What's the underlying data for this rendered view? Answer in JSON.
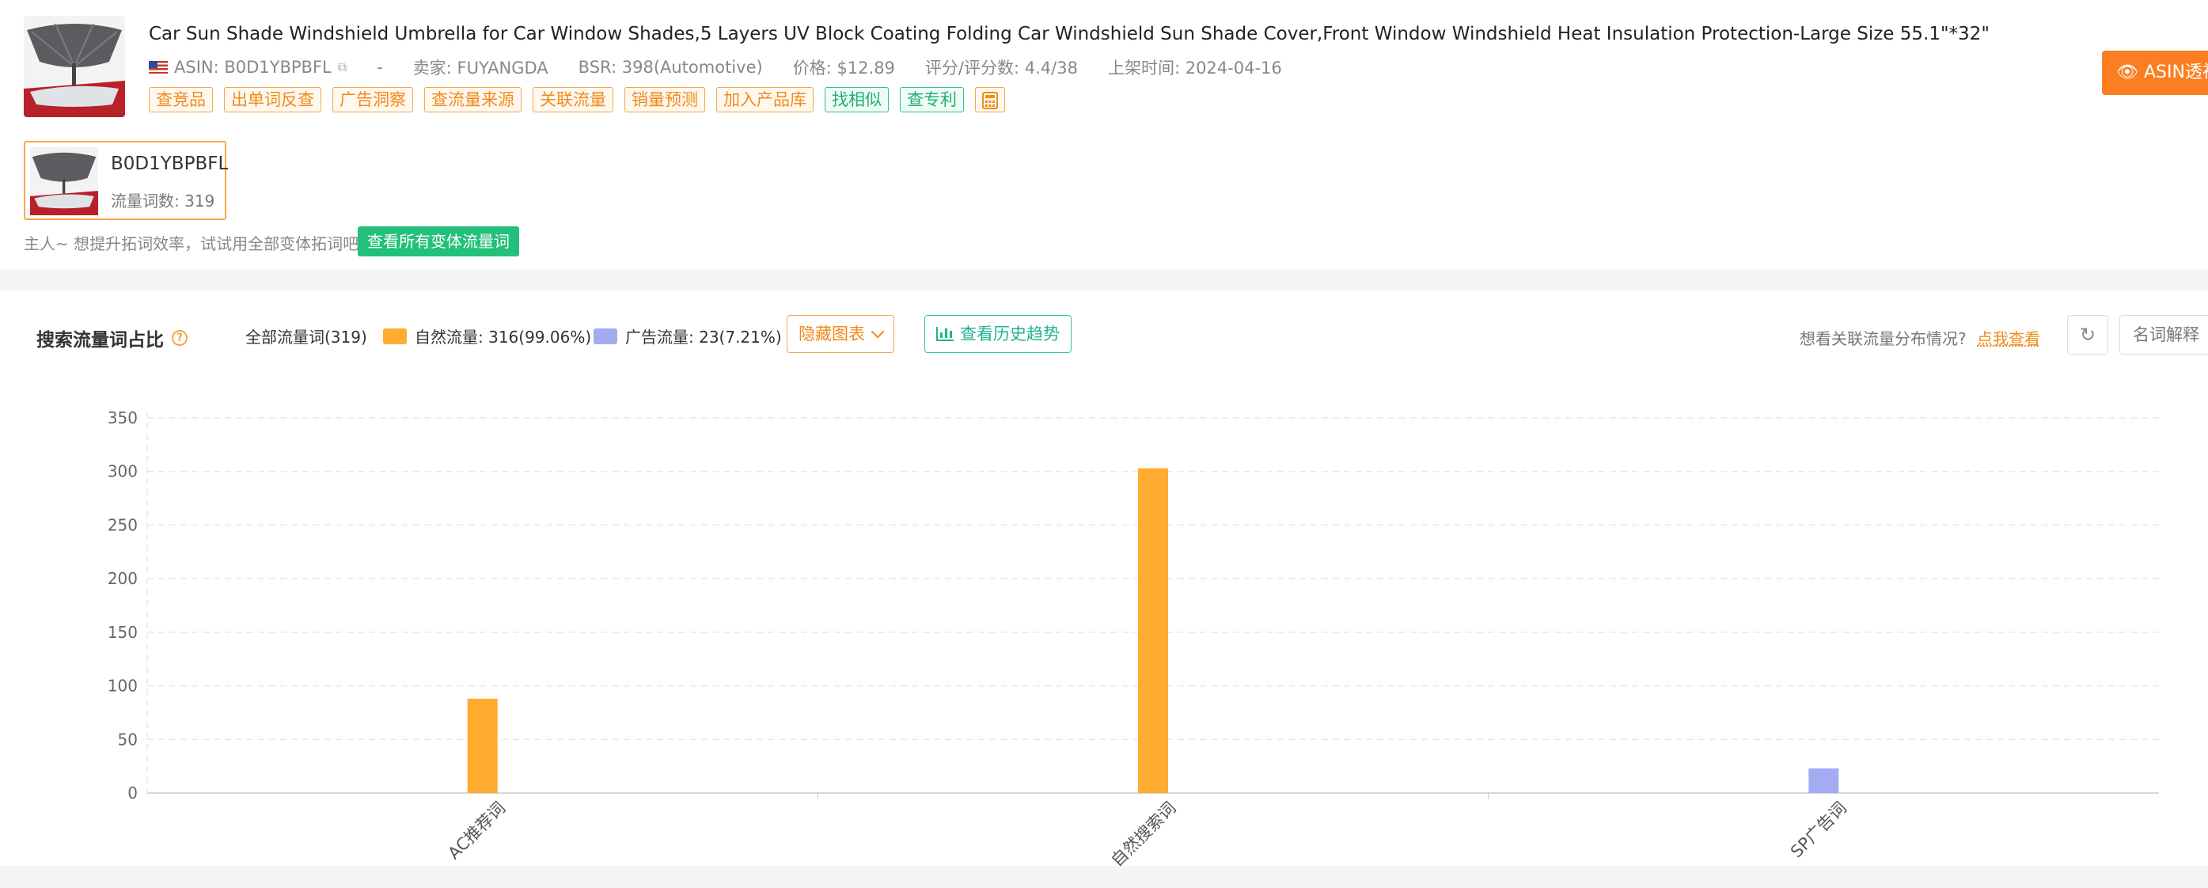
{
  "product": {
    "title": "Car Sun Shade Windshield Umbrella for Car Window Shades,5 Layers UV Block Coating Folding Car Windshield Sun Shade Cover,Front Window Windshield Heat Insulation Protection-Large Size 55.1\"*32\"",
    "asin": "ASIN: B0D1YBPBFL",
    "dash": "-",
    "seller": "卖家: FUYANGDA",
    "bsr": "BSR: 398(Automotive)",
    "price": "价格: $12.89",
    "rating": "评分/评分数: 4.4/38",
    "listed": "上架时间: 2024-04-16",
    "tags": [
      {
        "label": "查竞品",
        "style": "orange"
      },
      {
        "label": "出单词反查",
        "style": "orange"
      },
      {
        "label": "广告洞察",
        "style": "orange"
      },
      {
        "label": "查流量来源",
        "style": "orange"
      },
      {
        "label": "关联流量",
        "style": "orange"
      },
      {
        "label": "销量预测",
        "style": "orange"
      },
      {
        "label": "加入产品库",
        "style": "orange"
      },
      {
        "label": "找相似",
        "style": "green"
      },
      {
        "label": "查专利",
        "style": "green"
      }
    ],
    "asin_button": "ASIN透视"
  },
  "variant": {
    "asin": "B0D1YBPBFL",
    "traffic_count": "流量词数: 319"
  },
  "hint": {
    "text": "主人~ 想提升拓词效率，试试用全部变体拓词吧!",
    "button": "查看所有变体流量词"
  },
  "chart_section": {
    "title": "搜索流量词占比",
    "legend_all": "全部流量词(319)",
    "legend_natural": "自然流量: 316(99.06%)",
    "legend_ad": "广告流量: 23(7.21%)",
    "hide_chart": "隐藏图表",
    "history": "查看历史趋势",
    "related_text": "想看关联流量分布情况?",
    "related_link": "点我查看",
    "explain": "名词解释"
  },
  "colors": {
    "natural": "#ffac30",
    "ad": "#a3abf2",
    "accent": "#fb7e22"
  },
  "chart_data": {
    "type": "bar",
    "categories": [
      "AC推荐词",
      "自然搜索词",
      "SP广告词"
    ],
    "series": [
      {
        "name": "自然流量",
        "values": [
          88,
          303,
          0
        ]
      },
      {
        "name": "广告流量",
        "values": [
          0,
          0,
          23
        ]
      }
    ],
    "yticks": [
      "0",
      "50",
      "100",
      "150",
      "200",
      "250",
      "300",
      "350"
    ],
    "ylim": [
      0,
      350
    ],
    "grid": true
  }
}
